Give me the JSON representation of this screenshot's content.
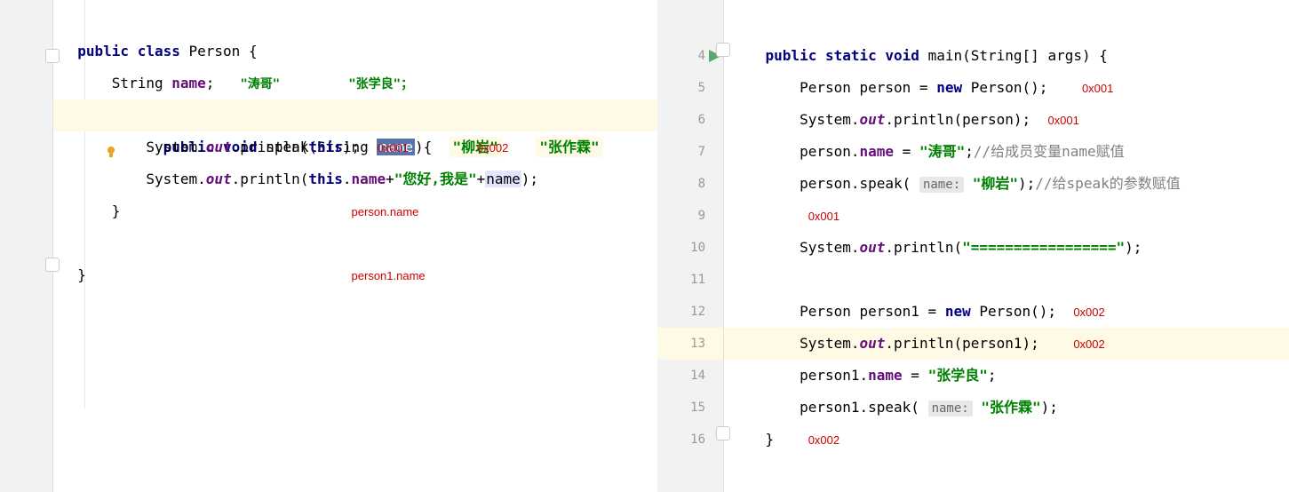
{
  "left": {
    "annotations": {
      "taoge": "\"涛哥\"",
      "zhangxueliang": "\"张学良\"；",
      "liuyan": "\"柳岩\"",
      "zhangzuolin": "\"张作霖\"",
      "addr1": "0x001",
      "addr2": "0x002",
      "personName": "person.name",
      "person1Name": "person1.name"
    },
    "code": {
      "l1_kw1": "public",
      "l1_kw2": "class",
      "l1_name": "Person {",
      "l2_type": "String",
      "l2_field": "name",
      "l2_semi": ";",
      "l3_kw1": "public",
      "l3_kw2": "void",
      "l3_method": "speak(String ",
      "l3_param": "name",
      "l3_end": "){",
      "l4_sys": "System.",
      "l4_out": "out",
      "l4_print": ".println(",
      "l4_this": "this",
      "l4_end": ");",
      "l5_sys": "System.",
      "l5_out": "out",
      "l5_print": ".println(",
      "l5_this": "this",
      "l5_dot": ".",
      "l5_field": "name",
      "l5_plus1": "+",
      "l5_str": "\"您好,我是\"",
      "l5_plus2": "+",
      "l5_name": "name",
      "l5_end": ");",
      "l6": "}",
      "l7": "}"
    }
  },
  "right": {
    "lineNumbers": [
      "4",
      "5",
      "6",
      "7",
      "8",
      "9",
      "10",
      "11",
      "12",
      "13",
      "14",
      "15",
      "16"
    ],
    "annotations": {
      "addr1_a": "0x001",
      "addr1_b": "0x001",
      "addr1_c": "0x001",
      "addr2_a": "0x002",
      "addr2_b": "0x002",
      "addr2_c": "0x002",
      "comment1": "//给成员变量name赋值",
      "comment2": "//给speak的参数赋值"
    },
    "code": {
      "l4_kw1": "public",
      "l4_kw2": "static",
      "l4_kw3": "void",
      "l4_method": "main(String[] args) {",
      "l5_a": "Person person = ",
      "l5_new": "new",
      "l5_b": " Person();",
      "l6_a": "System.",
      "l6_out": "out",
      "l6_b": ".println(person);",
      "l7_a": "person.",
      "l7_field": "name",
      "l7_b": " = ",
      "l7_str": "\"涛哥\"",
      "l7_c": ";",
      "l8_a": "person.speak(",
      "l8_hint": "name:",
      "l8_str": "\"柳岩\"",
      "l8_b": ");",
      "l10_a": "System.",
      "l10_out": "out",
      "l10_b": ".println(",
      "l10_str": "\"=================\"",
      "l10_c": ");",
      "l12_a": "Person person1 = ",
      "l12_new": "new",
      "l12_b": " Person();",
      "l13_a": "System.",
      "l13_out": "out",
      "l13_b": ".println(person1);",
      "l14_a": "person1.",
      "l14_field": "name",
      "l14_b": " = ",
      "l14_str": "\"张学良\"",
      "l14_c": ";",
      "l15_a": "person1.speak(",
      "l15_hint": "name:",
      "l15_str": "\"张作霖\"",
      "l15_b": ");",
      "l16": "}"
    }
  }
}
